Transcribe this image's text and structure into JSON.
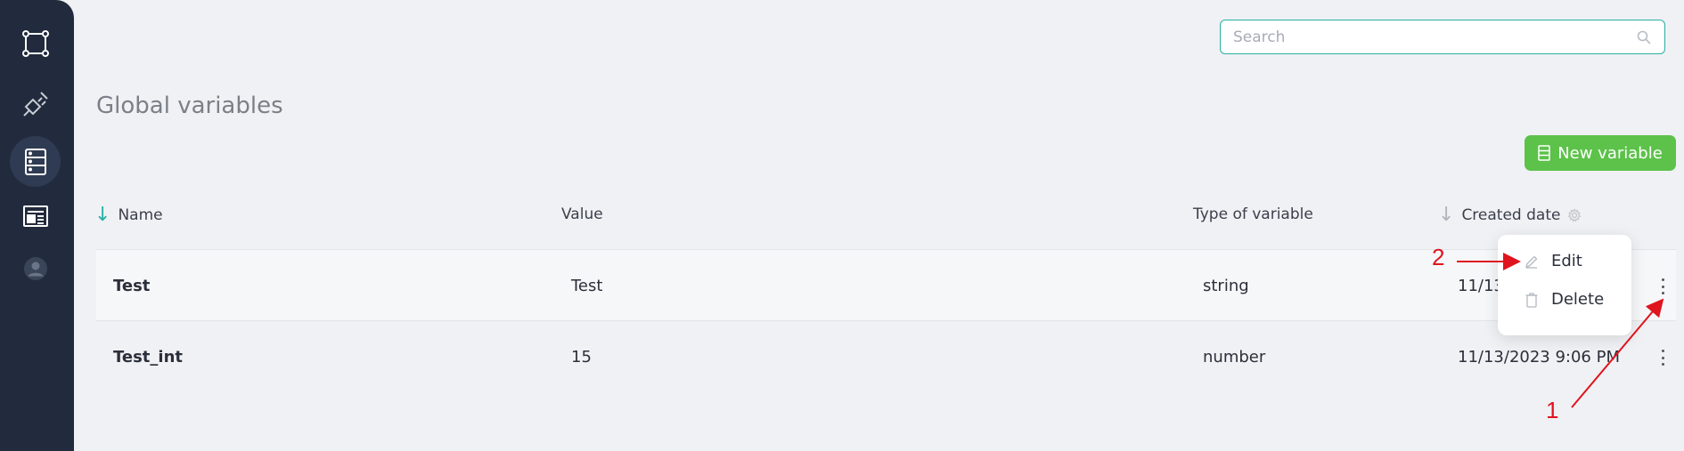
{
  "sidebar": {
    "items": [
      {
        "icon": "workflow-icon"
      },
      {
        "icon": "plug-icon"
      },
      {
        "icon": "database-icon",
        "active": true
      },
      {
        "icon": "newspaper-icon"
      },
      {
        "icon": "user-avatar-icon"
      }
    ]
  },
  "search": {
    "placeholder": "Search"
  },
  "page": {
    "title": "Global variables"
  },
  "toolbar": {
    "new_variable_label": "New variable"
  },
  "table": {
    "columns": {
      "name": "Name",
      "value": "Value",
      "type": "Type of variable",
      "created": "Created date"
    },
    "rows": [
      {
        "name": "Test",
        "value": "Test",
        "type": "string",
        "created": "11/13"
      },
      {
        "name": "Test_int",
        "value": "15",
        "type": "number",
        "created": "11/13/2023 9:06 PM"
      }
    ]
  },
  "context_menu": {
    "edit_label": "Edit",
    "delete_label": "Delete"
  },
  "annotations": {
    "label_1": "1",
    "label_2": "2",
    "color": "#e0141e"
  },
  "colors": {
    "sidebar": "#222b3d",
    "accent_teal": "#27b0a5",
    "button_green": "#5cc24a",
    "background": "#f0f1f4"
  }
}
